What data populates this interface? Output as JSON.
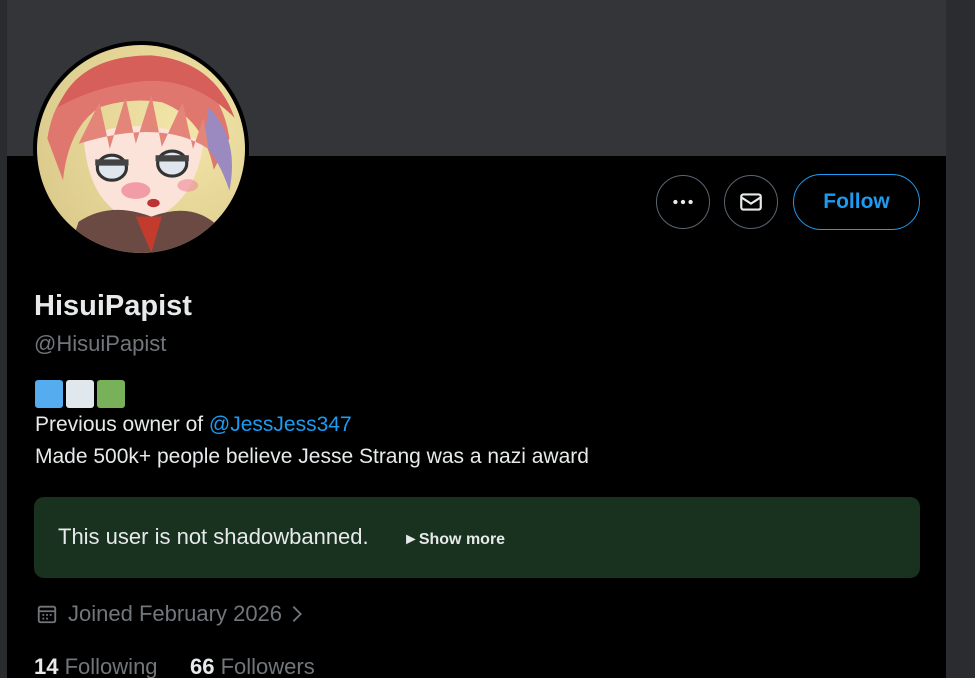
{
  "profile": {
    "display_name": "HisuiPapist",
    "handle": "@HisuiPapist",
    "bio_prefix": "Previous owner of ",
    "bio_mention": "@JessJess347",
    "bio_line2": "Made 500k+ people believe Jesse Strang was a nazi award",
    "flag_colors": [
      "#55acee",
      "#e1e8ed",
      "#78b159"
    ],
    "joined": "Joined February 2026",
    "following_count": "14",
    "following_label": "Following",
    "followers_count": "66",
    "followers_label": "Followers"
  },
  "actions": {
    "more_icon": "more-icon",
    "message_icon": "envelope-icon",
    "follow_label": "Follow"
  },
  "notice": {
    "text": "This user is not shadowbanned.",
    "show_more": "►Show more",
    "background": "#18321f"
  },
  "colors": {
    "accent": "#1d9bf0",
    "text": "#e7e9ea",
    "muted": "#71767b",
    "banner": "#333539"
  }
}
